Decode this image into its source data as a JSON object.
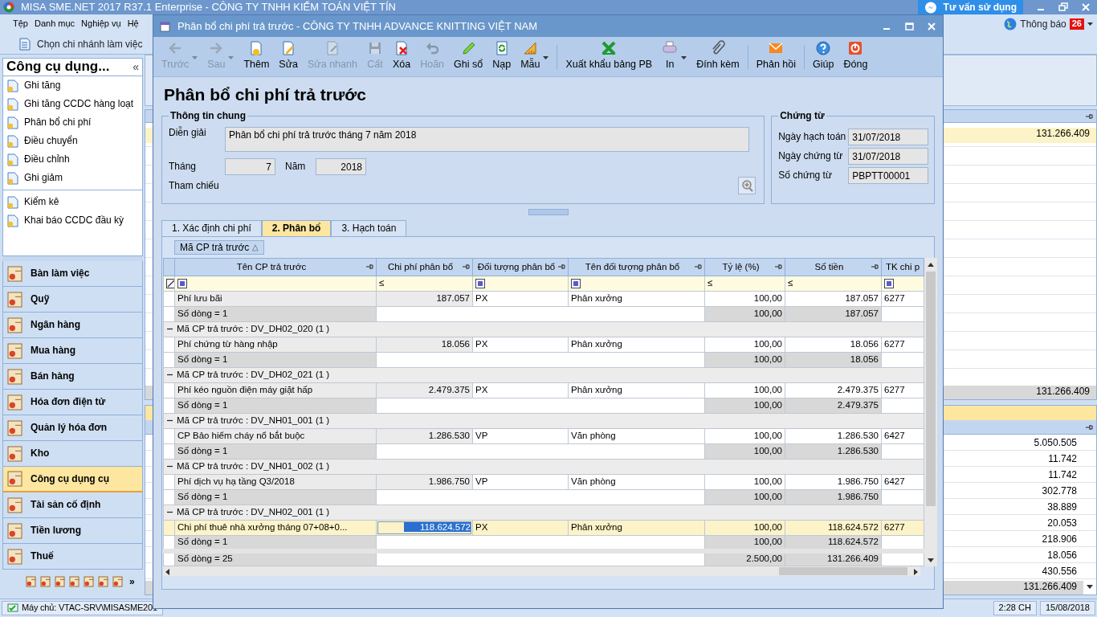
{
  "app": {
    "title": "MISA SME.NET 2017 R37.1 Enterprise - CÔNG TY TNHH KIỂM TOÁN VIỆT TÍN",
    "support_button": "Tư vấn sử dụng",
    "menu": [
      "Tệp",
      "Danh mục",
      "Nghiệp vụ",
      "Hệ"
    ],
    "branch_button": "Chọn chi nhánh làm việc",
    "notification": {
      "label": "Thông báo",
      "count": "26"
    }
  },
  "sidebar": {
    "title": "Công cụ dụng...",
    "collapse": "«",
    "task_groups": [
      [
        "Ghi tăng",
        "Ghi tăng CCDC hàng loạt",
        "Phân bổ chi phí",
        "Điều chuyển",
        "Điều chỉnh",
        "Ghi giảm"
      ],
      [
        "Kiểm kê",
        "Khai báo CCDC đầu kỳ"
      ]
    ],
    "modules": [
      {
        "label": "Bàn làm việc",
        "selected": false
      },
      {
        "label": "Quỹ",
        "selected": false
      },
      {
        "label": "Ngân hàng",
        "selected": false
      },
      {
        "label": "Mua hàng",
        "selected": false
      },
      {
        "label": "Bán hàng",
        "selected": false
      },
      {
        "label": "Hóa đơn điện tử",
        "selected": false
      },
      {
        "label": "Quản lý hóa đơn",
        "selected": false
      },
      {
        "label": "Kho",
        "selected": false
      },
      {
        "label": "Công cụ dụng cụ",
        "selected": true
      },
      {
        "label": "Tài sản cố định",
        "selected": false
      },
      {
        "label": "Tiền lương",
        "selected": false
      },
      {
        "label": "Thuế",
        "selected": false
      }
    ],
    "more": "»"
  },
  "background": {
    "top_rows": [
      "131.266.409"
    ],
    "top_total": "131.266.409",
    "bottom_rows": [
      "5.050.505",
      "11.742",
      "11.742",
      "302.778",
      "38.889",
      "20.053",
      "218.906",
      "18.056",
      "430.556"
    ],
    "bottom_total": "131.266.409"
  },
  "dialog": {
    "title": "Phân bổ chi phí trả trước - CÔNG TY TNHH ADVANCE KNITTING VIỆT NAM",
    "toolbar": [
      {
        "label": "Trước",
        "disabled": true,
        "dropdown": true,
        "separator_before": false
      },
      {
        "label": "Sau",
        "disabled": true,
        "dropdown": true,
        "separator_before": false
      },
      {
        "label": "Thêm",
        "disabled": false,
        "dropdown": false,
        "separator_before": false
      },
      {
        "label": "Sửa",
        "disabled": false,
        "dropdown": false,
        "separator_before": false
      },
      {
        "label": "Sửa nhanh",
        "disabled": true,
        "dropdown": false,
        "separator_before": false
      },
      {
        "label": "Cất",
        "disabled": true,
        "dropdown": false,
        "separator_before": false
      },
      {
        "label": "Xóa",
        "disabled": false,
        "dropdown": false,
        "separator_before": false
      },
      {
        "label": "Hoãn",
        "disabled": true,
        "dropdown": false,
        "separator_before": false
      },
      {
        "label": "Ghi sổ",
        "disabled": false,
        "dropdown": false,
        "separator_before": false
      },
      {
        "label": "Nạp",
        "disabled": false,
        "dropdown": false,
        "separator_before": false
      },
      {
        "label": "Mẫu",
        "disabled": false,
        "dropdown": true,
        "separator_before": false
      },
      {
        "label": "Xuất khẩu bảng PB",
        "disabled": false,
        "dropdown": false,
        "separator_before": true
      },
      {
        "label": "In",
        "disabled": false,
        "dropdown": true,
        "separator_before": false
      },
      {
        "label": "Đính kèm",
        "disabled": false,
        "dropdown": false,
        "separator_before": false
      },
      {
        "label": "Phản hồi",
        "disabled": false,
        "dropdown": false,
        "separator_before": true
      },
      {
        "label": "Giúp",
        "disabled": false,
        "dropdown": false,
        "separator_before": true
      },
      {
        "label": "Đóng",
        "disabled": false,
        "dropdown": false,
        "separator_before": false
      }
    ],
    "heading": "Phân bổ chi phí trả trước",
    "general": {
      "legend": "Thông tin chung",
      "description": {
        "label": "Diễn giải",
        "value": "Phân bổ chi phí trả trước tháng 7 năm 2018"
      },
      "month": {
        "label": "Tháng",
        "value": "7"
      },
      "year": {
        "label": "Năm",
        "value": "2018"
      },
      "reference": {
        "label": "Tham chiếu"
      }
    },
    "voucher": {
      "legend": "Chứng từ",
      "fields": [
        {
          "label": "Ngày hạch toán",
          "value": "31/07/2018"
        },
        {
          "label": "Ngày chứng từ",
          "value": "31/07/2018"
        },
        {
          "label": "Số chứng từ",
          "value": "PBPTT00001"
        }
      ]
    },
    "tabs": [
      {
        "label": "1. Xác định chi phí",
        "selected": false
      },
      {
        "label": "2. Phân bổ",
        "selected": true
      },
      {
        "label": "3. Hạch toán",
        "selected": false
      }
    ],
    "group_by": {
      "label": "Mã CP trả trước",
      "sort": "△"
    },
    "grid": {
      "columns": [
        "Tên CP trả trước",
        "Chi phí phân bổ",
        "Đối tượng phân bổ",
        "Tên đối tượng phân bổ",
        "Tỷ lệ (%)",
        "Số tiền",
        "TK chi p"
      ],
      "filters": [
        {
          "kind": "select"
        },
        {
          "kind": "compare",
          "symbol": "≤"
        },
        {
          "kind": "select"
        },
        {
          "kind": "select"
        },
        {
          "kind": "compare",
          "symbol": "≤"
        },
        {
          "kind": "compare",
          "symbol": "≤"
        },
        {
          "kind": "select"
        }
      ],
      "rows": [
        {
          "kind": "data",
          "name": "Phí lưu bãi",
          "amount": "187.057",
          "object": "PX",
          "object_name": "Phân xưởng",
          "rate": "100,00",
          "money": "187.057",
          "account": "6277",
          "selected": false
        },
        {
          "kind": "summary",
          "label": "Số dòng = 1",
          "rate": "100,00",
          "money": "187.057"
        },
        {
          "kind": "group",
          "label": "Mã CP trả trước : DV_DH02_020 (1 )",
          "expanded": true
        },
        {
          "kind": "data",
          "name": "Phí chứng từ hàng nhập",
          "amount": "18.056",
          "object": "PX",
          "object_name": "Phân xưởng",
          "rate": "100,00",
          "money": "18.056",
          "account": "6277",
          "selected": false
        },
        {
          "kind": "summary",
          "label": "Số dòng = 1",
          "rate": "100,00",
          "money": "18.056"
        },
        {
          "kind": "group",
          "label": "Mã CP trả trước : DV_DH02_021 (1 )",
          "expanded": true
        },
        {
          "kind": "data",
          "name": "Phí kéo nguồn điện máy giặt hấp",
          "amount": "2.479.375",
          "object": "PX",
          "object_name": "Phân xưởng",
          "rate": "100,00",
          "money": "2.479.375",
          "account": "6277",
          "selected": false
        },
        {
          "kind": "summary",
          "label": "Số dòng = 1",
          "rate": "100,00",
          "money": "2.479.375"
        },
        {
          "kind": "group",
          "label": "Mã CP trả trước : DV_NH01_001 (1 )",
          "expanded": true
        },
        {
          "kind": "data",
          "name": "CP Bảo hiểm cháy nổ bắt buộc",
          "amount": "1.286.530",
          "object": "VP",
          "object_name": "Văn phòng",
          "rate": "100,00",
          "money": "1.286.530",
          "account": "6427",
          "selected": false
        },
        {
          "kind": "summary",
          "label": "Số dòng = 1",
          "rate": "100,00",
          "money": "1.286.530"
        },
        {
          "kind": "group",
          "label": "Mã CP trả trước : DV_NH01_002 (1 )",
          "expanded": true
        },
        {
          "kind": "data",
          "name": "Phí dịch vụ hạ tầng Q3/2018",
          "amount": "1.986.750",
          "object": "VP",
          "object_name": "Văn phòng",
          "rate": "100,00",
          "money": "1.986.750",
          "account": "6427",
          "selected": false
        },
        {
          "kind": "summary",
          "label": "Số dòng = 1",
          "rate": "100,00",
          "money": "1.986.750"
        },
        {
          "kind": "group",
          "label": "Mã CP trả trước : DV_NH02_001 (1 )",
          "expanded": true
        },
        {
          "kind": "data",
          "name": "Chi phí thuê nhà xưởng tháng 07+08+0...",
          "amount": "118.624.572",
          "object": "PX",
          "object_name": "Phân xưởng",
          "rate": "100,00",
          "money": "118.624.572",
          "account": "6277",
          "selected": true
        },
        {
          "kind": "summary",
          "label": "Số dòng = 1",
          "rate": "100,00",
          "money": "118.624.572"
        }
      ],
      "footer": {
        "label": "Số dòng = 25",
        "rate": "2.500,00",
        "money": "131.266.409"
      }
    }
  },
  "status_bar": {
    "server": "Máy chủ: VTAC-SRV\\MISASME201",
    "time": "2:28 CH",
    "date": "15/08/2018"
  }
}
